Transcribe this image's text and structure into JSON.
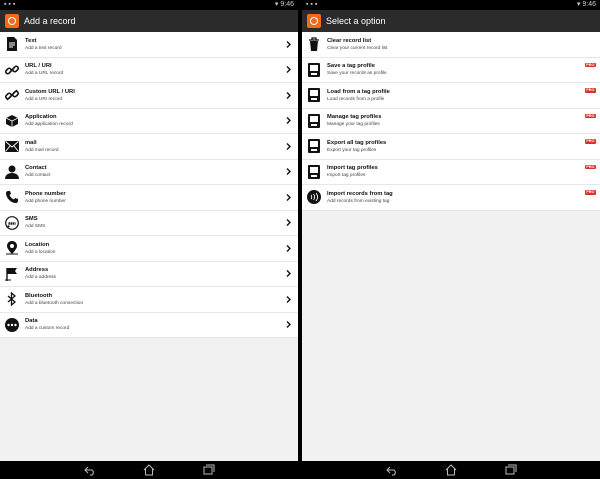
{
  "left": {
    "status": {
      "left": "▪ ▪ ▪",
      "right": "▾ 9:46"
    },
    "title": "Add a record",
    "items": [
      {
        "title": "Text",
        "subtitle": "Add a text record",
        "icon": "text-document-icon"
      },
      {
        "title": "URL / URI",
        "subtitle": "Add a URL record",
        "icon": "link-icon"
      },
      {
        "title": "Custom URL / URI",
        "subtitle": "Add a URI record",
        "icon": "custom-link-icon"
      },
      {
        "title": "Application",
        "subtitle": "Add application record",
        "icon": "package-icon"
      },
      {
        "title": "mail",
        "subtitle": "Add mail record",
        "icon": "mail-icon"
      },
      {
        "title": "Contact",
        "subtitle": "Add contact",
        "icon": "contact-person-icon"
      },
      {
        "title": "Phone number",
        "subtitle": "Add phone number",
        "icon": "phone-icon"
      },
      {
        "title": "SMS",
        "subtitle": "Add SMS",
        "icon": "sms-bubble-icon"
      },
      {
        "title": "Location",
        "subtitle": "Add a location",
        "icon": "location-pin-icon"
      },
      {
        "title": "Address",
        "subtitle": "Add a address",
        "icon": "flag-icon"
      },
      {
        "title": "Bluetooth",
        "subtitle": "Add a bluetooth connection",
        "icon": "bluetooth-icon"
      },
      {
        "title": "Data",
        "subtitle": "Add a custom record",
        "icon": "more-dots-icon"
      }
    ]
  },
  "right": {
    "status": {
      "left": "▪ ▪ ▪",
      "right": "▾ 9:46"
    },
    "title": "Select a option",
    "pro_label": "PRO",
    "items": [
      {
        "title": "Clear record list",
        "subtitle": "Clear your current record list",
        "icon": "trash-icon",
        "pro": false
      },
      {
        "title": "Save a tag profile",
        "subtitle": "Save your records as profile",
        "icon": "save-profile-icon",
        "pro": true
      },
      {
        "title": "Load from a tag profile",
        "subtitle": "Load records from a profile",
        "icon": "load-profile-icon",
        "pro": true
      },
      {
        "title": "Manage tag profiles",
        "subtitle": "Manage your tag profiles",
        "icon": "manage-profile-icon",
        "pro": true
      },
      {
        "title": "Export all tag profiles",
        "subtitle": "Export your tag profiles",
        "icon": "export-profile-icon",
        "pro": true
      },
      {
        "title": "Import tag profiles",
        "subtitle": "Import tag profiles",
        "icon": "import-profile-icon",
        "pro": true
      },
      {
        "title": "Import records from tag",
        "subtitle": "Add records from existing tag",
        "icon": "nfc-tag-icon",
        "pro": true
      }
    ]
  },
  "colors": {
    "accent": "#f26a1b",
    "appbar": "#2b2b2b",
    "pro": "#d9322a"
  }
}
